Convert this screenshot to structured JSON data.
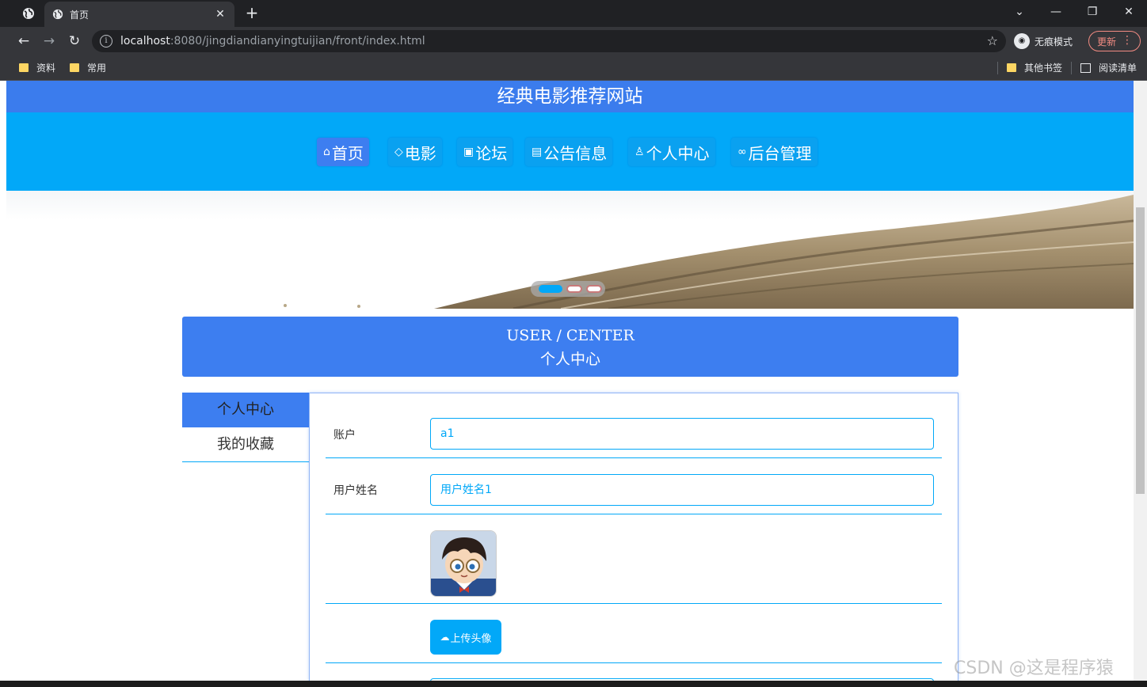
{
  "browser": {
    "tab_title": "首页",
    "url_host": "localhost",
    "url_rest": ":8080/jingdiandianyingtuijian/front/index.html",
    "incognito_label": "无痕模式",
    "update_label": "更新",
    "bookmarks": [
      "资料",
      "常用"
    ],
    "bookmarks_right": [
      "其他书签",
      "阅读清单"
    ]
  },
  "site": {
    "title": "经典电影推荐网站",
    "nav": [
      {
        "label": "首页",
        "icon": "home-icon"
      },
      {
        "label": "电影",
        "icon": "tag-icon"
      },
      {
        "label": "论坛",
        "icon": "gift-icon"
      },
      {
        "label": "公告信息",
        "icon": "document-icon"
      },
      {
        "label": "个人中心",
        "icon": "user-icon"
      },
      {
        "label": "后台管理",
        "icon": "link-icon"
      }
    ],
    "active_nav": "首页"
  },
  "carousel": {
    "slide_count": 3,
    "active_index": 0
  },
  "user_center": {
    "title_en": "USER / CENTER",
    "title_cn": "个人中心",
    "side_menu": [
      "个人中心",
      "我的收藏"
    ],
    "active_side": "个人中心",
    "form": {
      "account_label": "账户",
      "account_value": "a1",
      "name_label": "用户姓名",
      "name_value": "用户姓名1",
      "upload_label": "上传头像"
    }
  },
  "watermark": "CSDN @这是程序猿",
  "colors": {
    "primary": "#3d7ef0",
    "nav_bg": "#02a8f8",
    "header_bg": "#3b7ced"
  }
}
